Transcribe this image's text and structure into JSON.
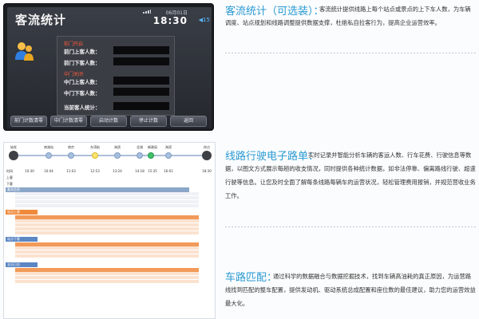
{
  "device": {
    "title": "客流统计",
    "date": "06月01日",
    "time": "18:30",
    "volume": "15",
    "front_door_open": "前门开启",
    "front_on": "前门上客人数：",
    "front_off": "前门下客人数：",
    "middle_door_closed": "中门关闭",
    "middle_on": "中门上客人数：",
    "middle_off": "中门下客人数：",
    "current": "当前客人统计：",
    "buttons": [
      "前门计数清零",
      "中门计数清零",
      "启动计数",
      "停止计数",
      "返回"
    ]
  },
  "route_sheet": {
    "stops": [
      "始发",
      "南湖站",
      "南京",
      "东湾街",
      "海滨",
      "北湖",
      "邮政局",
      "海滨",
      "终点"
    ],
    "times": [
      "10:30",
      "10:44",
      "11:03",
      "12:53",
      "13:24",
      "14:18",
      "15:35",
      "16:01",
      "18:30"
    ],
    "row_labels": [
      "时间",
      "上客",
      "下客"
    ],
    "sections": [
      "基本信息",
      "站点上客",
      "站点下客",
      "支出日志"
    ]
  },
  "blocks": [
    {
      "title": "客流统计（可选装）：",
      "body": "客流统计提供线路上每个站点或景点的上下车人数，为车辆调度、站点规划和线路调整提供数据支撑，杜绝私自拉客行为，提高企业运营效率。"
    },
    {
      "title": "线路行驶电子路单：",
      "body": "实时记录并智能分析车辆的客运人数、行车花费、行驶信息等数据，以图文方式展示每趟的收支情况，同时提供各种统计数据，如非法停靠、偏离路线行驶、超速行驶等信息。让您及时全面了解每条线路每辆车的运营状况，轻松管理费用报销，并规范营收业务工作。"
    },
    {
      "title": "车路匹配：",
      "body": "通过科学的数据融合与数据挖掘技术，找到车辆高油耗的真正原因，为运营路线找到匹配的整车配置，提供发动机、驱动系统总成配置和座位数的最佳建议，助力您的运营效益最大化。"
    }
  ]
}
